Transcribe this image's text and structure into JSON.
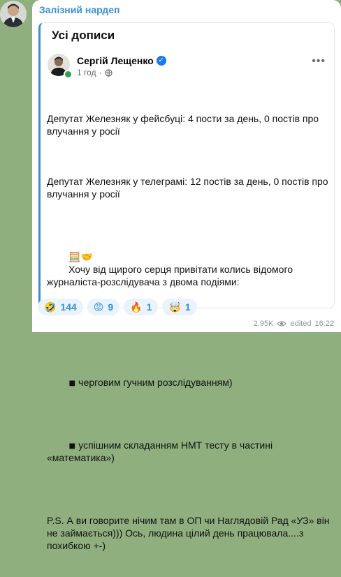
{
  "channel": {
    "name": "Залізний нардеп"
  },
  "card": {
    "title": "Усі дописи",
    "author": "Сергій Лещенко",
    "time": "1 год",
    "body": {
      "p1": "Депутат Железняк у фейсбуці: 4 пости за день, 0 постів про влучання у росії",
      "p2": "Депутат Железняк у телеграмі: 12 постів за день, 0 постів про влучання у росії",
      "p3": "Хочу від щирого серця привітати колись відомого журналіста-розслідувача з двома подіями:",
      "bullet1": "черговим гучним розслідуванням)",
      "bullet2": "успішним складанням НМТ тесту в частині «математика»)",
      "p4": "P.S. А ви говорите нічим там в ОП чи Наглядовій Рад «УЗ» він не займається))) Ось, людина цілий день працювала....з похибкою +-)"
    }
  },
  "reactions": [
    {
      "emoji": "🤣",
      "count": "144"
    },
    {
      "emoji": "😡",
      "count": "9"
    },
    {
      "emoji": "🔥",
      "count": "1"
    },
    {
      "emoji": "🤯",
      "count": "1"
    }
  ],
  "footer": {
    "views": "2.95K",
    "edited": "edited",
    "time": "16:22"
  }
}
